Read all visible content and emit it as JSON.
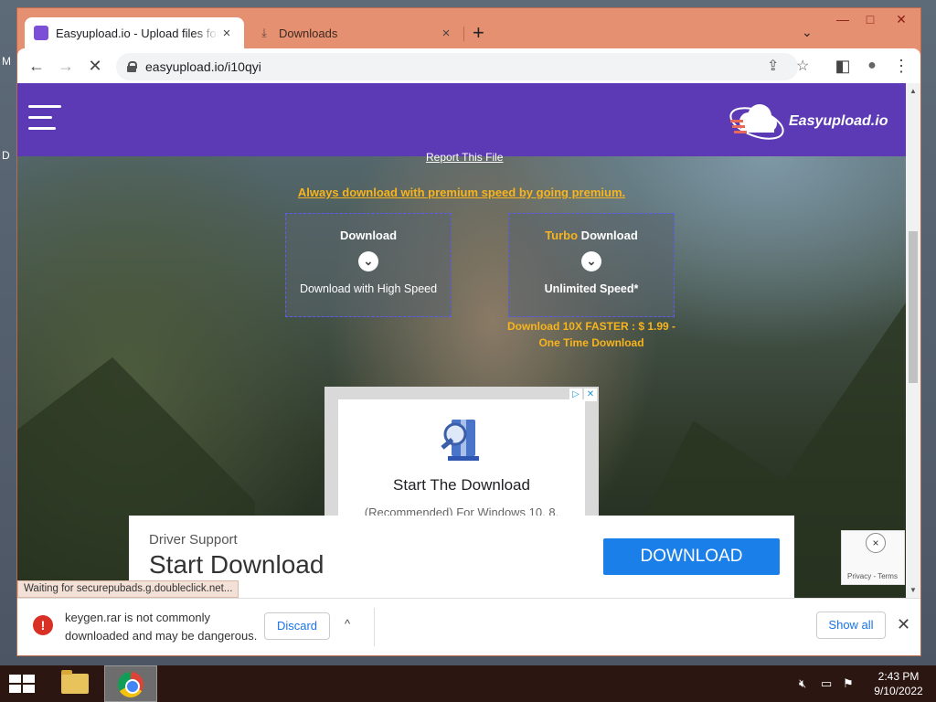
{
  "desktop": {
    "letters": [
      "M",
      "D"
    ]
  },
  "tabs": [
    {
      "title": "Easyupload.io - Upload files for free",
      "close": "×",
      "favicon_color": "#7b4fd6"
    },
    {
      "title": "Downloads",
      "close": "×",
      "icon": "download-icon"
    }
  ],
  "tabstrip": {
    "new_tab": "+",
    "tab_search": "⌄"
  },
  "window_buttons": {
    "minimize": "—",
    "maximize": "□",
    "close": "✕"
  },
  "toolbar": {
    "back": "←",
    "forward": "→",
    "reload": "✕",
    "url": "easyupload.io/i10qyi",
    "share": "⇪",
    "bookmark": "☆",
    "side_panel": "◧",
    "profile": "●",
    "menu": "⋮"
  },
  "site": {
    "brand": "Easyupload.io",
    "report": "Report This File",
    "premium_link": "Always download with premium speed by going premium.",
    "download_box": {
      "title": "Download",
      "sub": "Download with High Speed"
    },
    "turbo_box": {
      "title_accent": "Turbo",
      "title_rest": " Download",
      "sub": "Unlimited Speed*"
    },
    "price_line1": "Download 10X FASTER : $ 1.99 -",
    "price_line2": "One Time Download",
    "arrow": "⌄"
  },
  "ad_square": {
    "title": "Start The Download",
    "sub": "(Recommended) For Windows 10, 8,"
  },
  "ad_banner": {
    "eyebrow": "Driver Support",
    "headline": "Start Download",
    "button": "DOWNLOAD"
  },
  "recaptcha": {
    "close": "×",
    "privacy": "Privacy - Terms"
  },
  "status_text": "Waiting for securepubads.g.doubleclick.net...",
  "shelf": {
    "warning_line1": "keygen.rar is not commonly",
    "warning_line2": "downloaded and may be dangerous.",
    "discard": "Discard",
    "expand": "^",
    "show_all": "Show all",
    "close": "✕",
    "warn_glyph": "!"
  },
  "taskbar": {
    "time": "2:43 PM",
    "date": "9/10/2022",
    "tray_icons": [
      "volume-muted-icon",
      "network-icon",
      "action-center-icon"
    ]
  },
  "colors": {
    "header_purple": "#5c3ab5",
    "accent_orange": "#f7b41c",
    "window_frame": "#e69072"
  }
}
